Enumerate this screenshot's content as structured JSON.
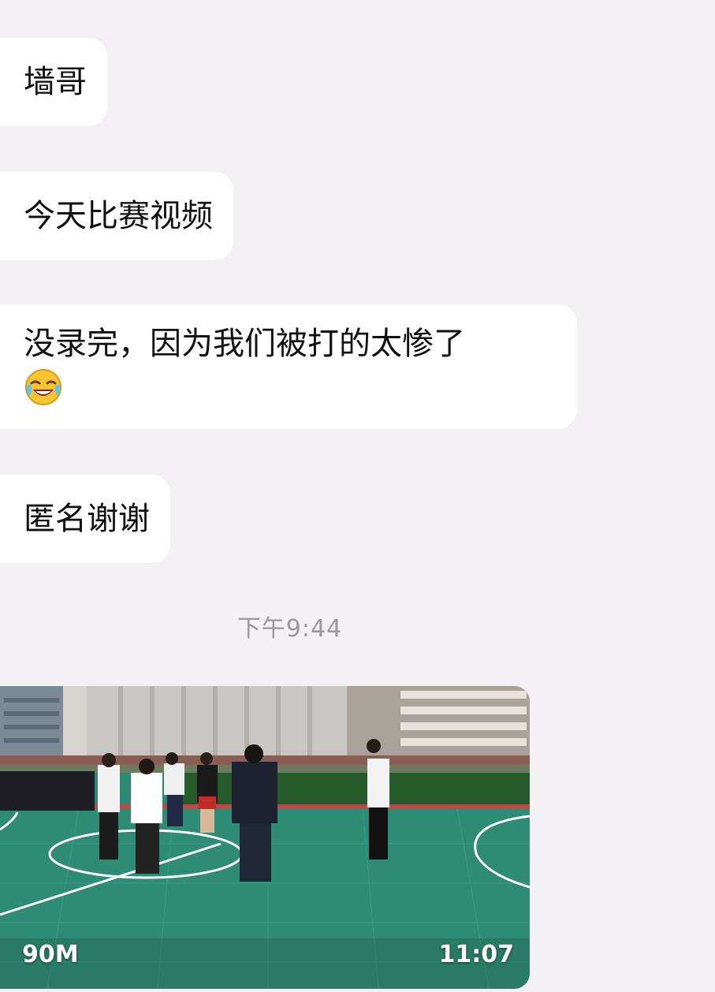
{
  "messages": [
    {
      "text": "墙哥"
    },
    {
      "text": "今天比赛视频"
    },
    {
      "text": "没录完，因为我们被打的太惨了",
      "emoji": "laughing-tears-emoji"
    },
    {
      "text": "匿名谢谢"
    }
  ],
  "timestamp": "下午9:44",
  "video": {
    "size": "90M",
    "duration": "11:07",
    "thumbnail": "basketball-court-scene"
  },
  "colors": {
    "background": "#f4f1f4",
    "bubble": "#ffffff",
    "timestamp": "#9a989b",
    "court": "#2c8a72"
  }
}
